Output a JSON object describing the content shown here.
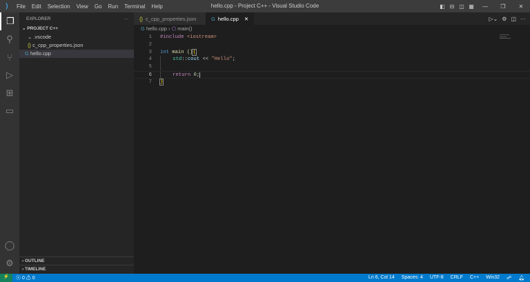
{
  "window": {
    "title": "hello.cpp - Project C++ - Visual Studio Code",
    "menu": [
      "File",
      "Edit",
      "Selection",
      "View",
      "Go",
      "Run",
      "Terminal",
      "Help"
    ]
  },
  "activity": [
    "files-icon",
    "search-icon",
    "source-control-icon",
    "run-debug-icon",
    "extensions-icon",
    "remote-explorer-icon"
  ],
  "sidebar": {
    "header": "EXPLORER",
    "more": "···",
    "project": "PROJECT C++",
    "folder": ".vscode",
    "file1": "c_cpp_properties.json",
    "file2": "hello.cpp",
    "outline": "OUTLINE",
    "timeline": "TIMELINE"
  },
  "tabs": [
    {
      "label": "c_cpp_properties.json",
      "icon": "{}"
    },
    {
      "label": "hello.cpp",
      "icon": "G"
    }
  ],
  "breadcrumb": {
    "file": "hello.cpp",
    "symbol": "main()"
  },
  "code": {
    "line_numbers": [
      "1",
      "2",
      "3",
      "4",
      "5",
      "6",
      "7"
    ],
    "l1a": "#include ",
    "l1b": "<iostream>",
    "l3a": "int ",
    "l3b": "main ",
    "l3c": "()",
    "l3d": "{",
    "l4a": "    ",
    "l4b": "std",
    "l4c": "::",
    "l4d": "cout",
    "l4e": " << ",
    "l4f": "\"Hello\"",
    "l4g": ";",
    "l6a": "    ",
    "l6b": "return ",
    "l6c": "0",
    "l6d": ";",
    "l7": "}"
  },
  "status": {
    "errors": "0",
    "warnings": "0",
    "position": "Ln 6, Col 14",
    "spaces": "Spaces: 4",
    "encoding": "UTF-8",
    "eol": "CRLF",
    "language": "C++",
    "config": "Win32"
  },
  "colors": {
    "accent": "#007acc",
    "titlebar": "#3c3c3c",
    "editor": "#1e1e1e"
  }
}
